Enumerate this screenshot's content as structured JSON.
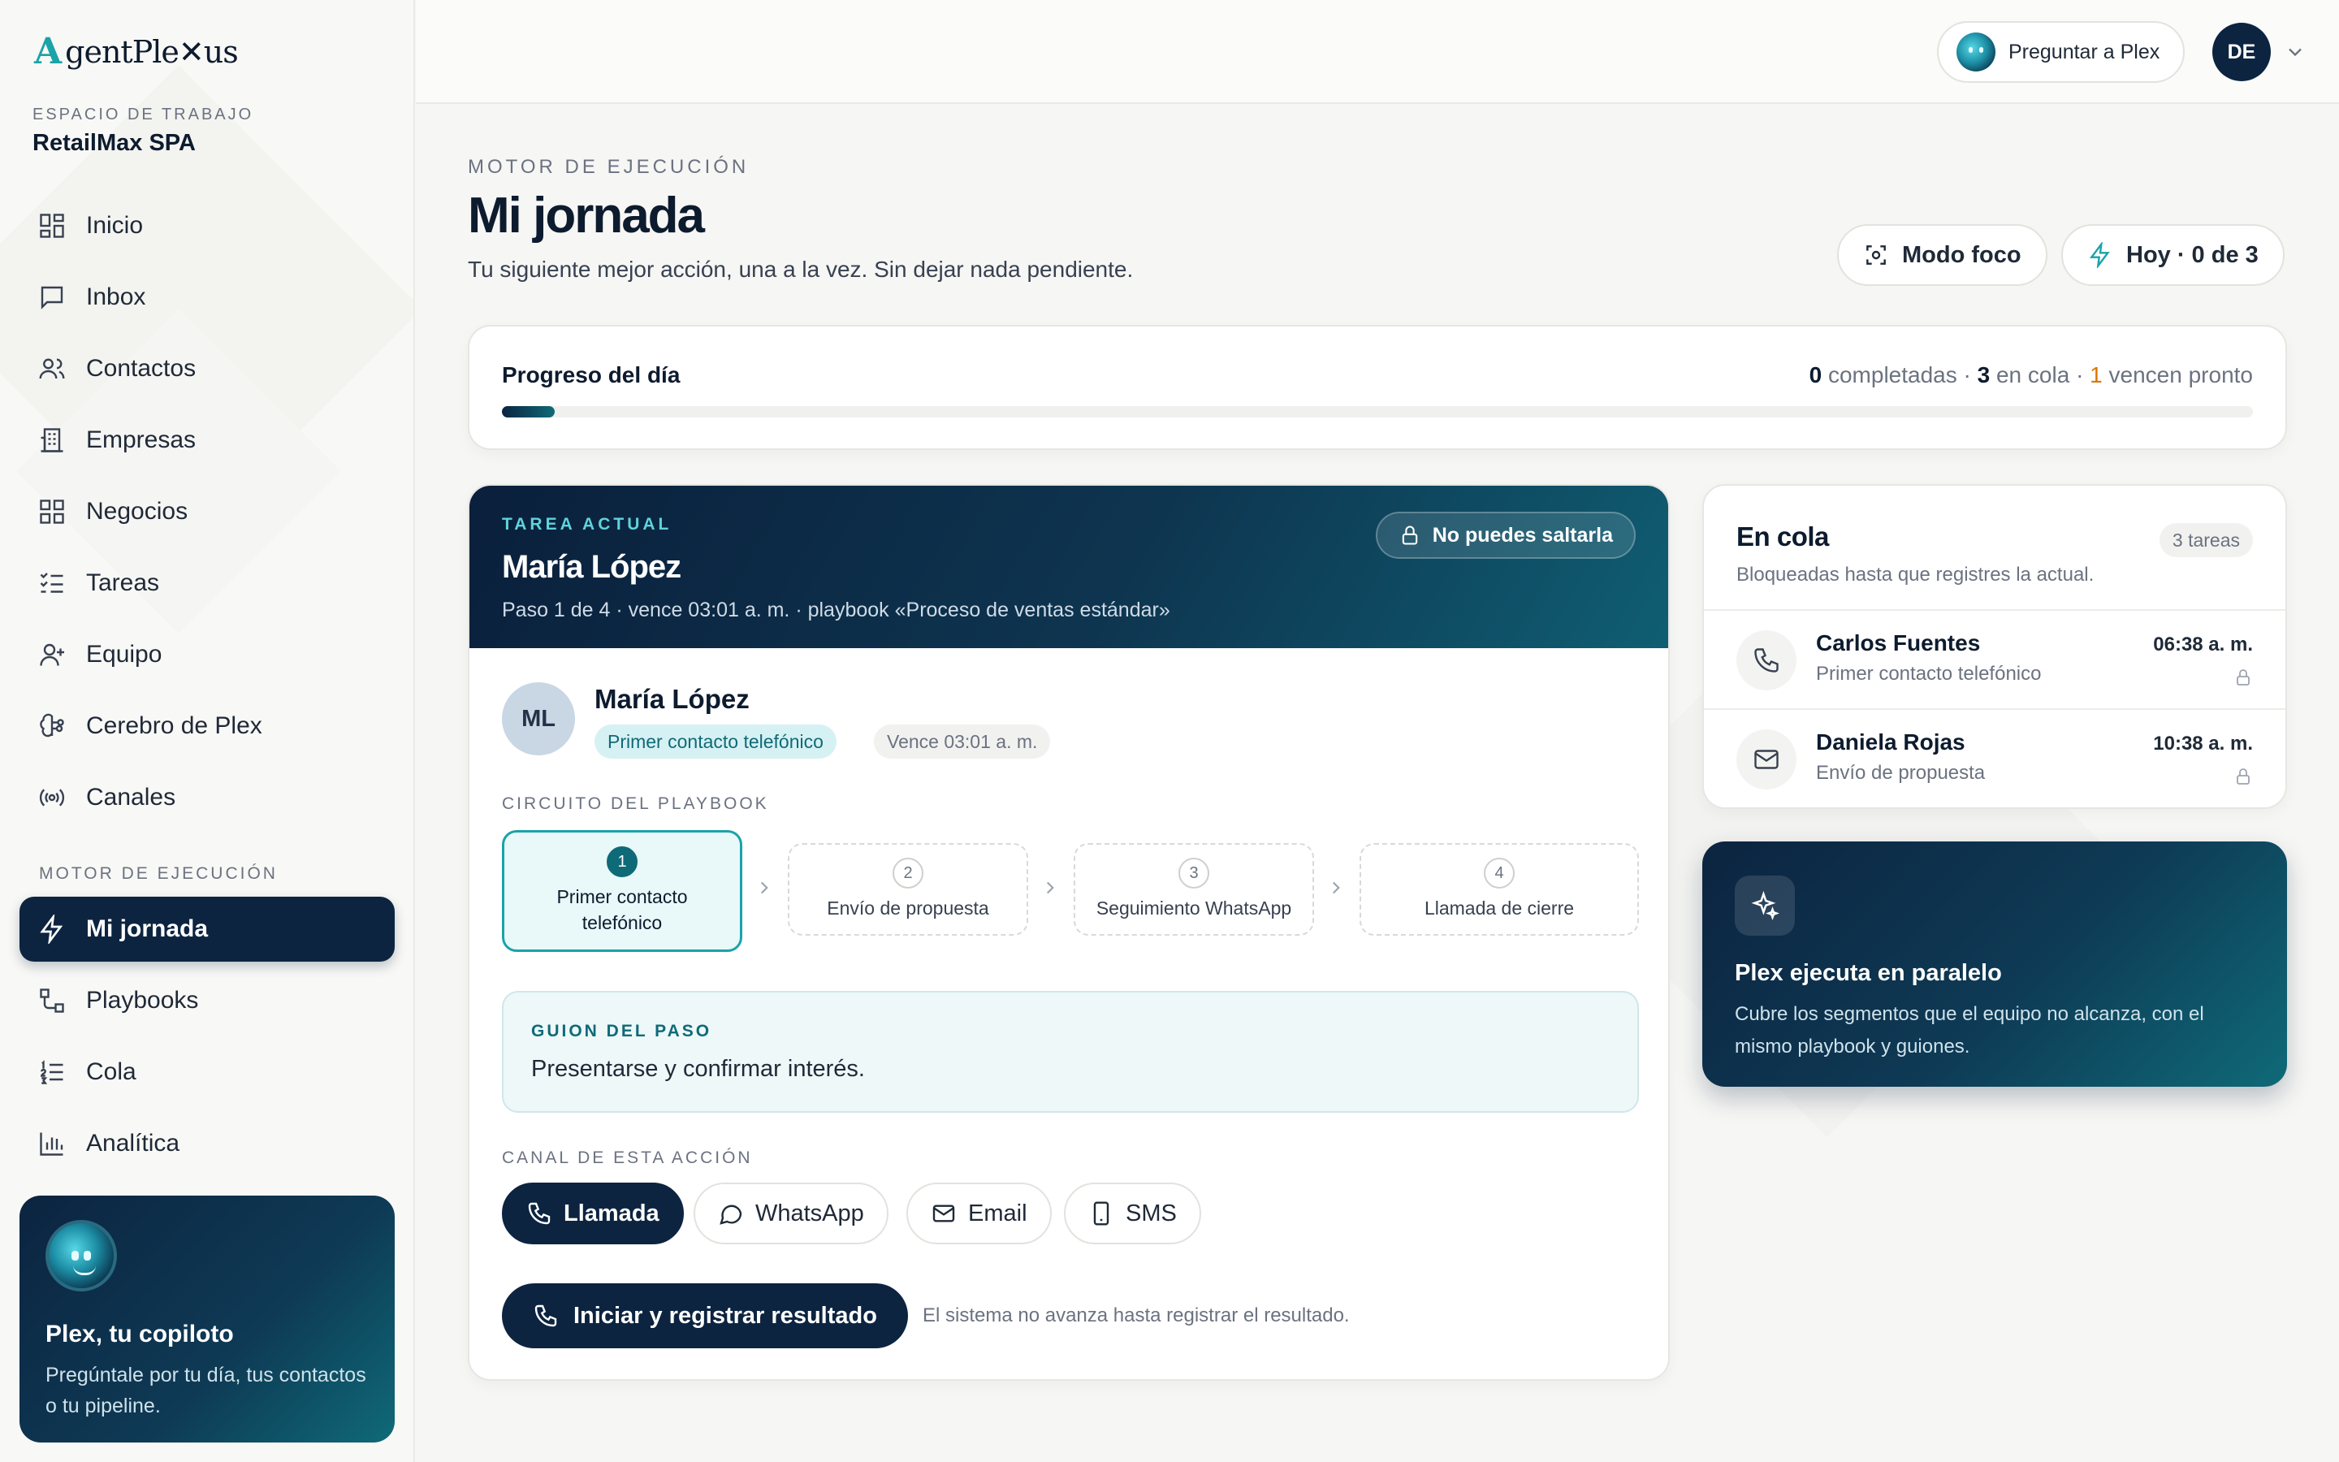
{
  "brand": {
    "logo_mark": "A",
    "logo_text": "gentPle✕us"
  },
  "workspace": {
    "label": "ESPACIO DE TRABAJO",
    "name": "RetailMax SPA"
  },
  "sidebar": {
    "items": [
      {
        "label": "Inicio",
        "icon": "grid-icon"
      },
      {
        "label": "Inbox",
        "icon": "message-icon"
      },
      {
        "label": "Contactos",
        "icon": "users-icon"
      },
      {
        "label": "Empresas",
        "icon": "building-icon"
      },
      {
        "label": "Negocios",
        "icon": "grid-icon"
      },
      {
        "label": "Tareas",
        "icon": "checklist-icon"
      },
      {
        "label": "Equipo",
        "icon": "user-plus-icon"
      },
      {
        "label": "Cerebro de Plex",
        "icon": "brain-icon"
      },
      {
        "label": "Canales",
        "icon": "broadcast-icon"
      }
    ],
    "section_label": "MOTOR DE EJECUCIÓN",
    "section_items": [
      {
        "label": "Mi jornada",
        "icon": "bolt-icon",
        "active": true
      },
      {
        "label": "Playbooks",
        "icon": "flow-icon"
      },
      {
        "label": "Cola",
        "icon": "list-ordered-icon"
      },
      {
        "label": "Analítica",
        "icon": "bar-chart-icon"
      }
    ],
    "copilot": {
      "title": "Plex, tu copiloto",
      "text": "Pregúntale por tu día, tus contactos o tu pipeline."
    }
  },
  "topbar": {
    "ask_label": "Preguntar a Plex",
    "avatar_initials": "DE"
  },
  "header": {
    "kicker": "MOTOR DE EJECUCIÓN",
    "title": "Mi jornada",
    "subtitle": "Tu siguiente mejor acción, una a la vez. Sin dejar nada pendiente.",
    "focus_button": "Modo foco",
    "today_button": "Hoy · 0 de 3"
  },
  "progress": {
    "title": "Progreso del día",
    "completed": "0",
    "completed_label": "completadas",
    "queued": "3",
    "queued_label": "en cola",
    "due_soon": "1",
    "due_soon_label": "vencen pronto",
    "sep": "·"
  },
  "task": {
    "kicker": "TAREA ACTUAL",
    "name": "María López",
    "meta": "Paso 1 de 4 · vence 03:01 a. m. · playbook «Proceso de ventas estándar»",
    "no_skip": "No puedes saltarla",
    "contact": {
      "initials": "ML",
      "name": "María López",
      "tag": "Primer contacto telefónico",
      "due": "Vence 03:01 a. m."
    },
    "circuit_label": "CIRCUITO DEL PLAYBOOK",
    "steps": [
      {
        "num": "1",
        "label": "Primer contacto telefónico"
      },
      {
        "num": "2",
        "label": "Envío de propuesta"
      },
      {
        "num": "3",
        "label": "Seguimiento WhatsApp"
      },
      {
        "num": "4",
        "label": "Llamada de cierre"
      }
    ],
    "script_label": "GUION DEL PASO",
    "script_text": "Presentarse y confirmar interés.",
    "channel_label": "CANAL DE ESTA ACCIÓN",
    "channels": [
      "Llamada",
      "WhatsApp",
      "Email",
      "SMS"
    ],
    "cta": "Iniciar y registrar resultado",
    "cta_note": "El sistema no avanza hasta registrar el resultado."
  },
  "queue": {
    "title": "En cola",
    "count": "3 tareas",
    "subtitle": "Bloqueadas hasta que registres la actual.",
    "items": [
      {
        "name": "Carlos Fuentes",
        "step": "Primer contacto telefónico",
        "time": "06:38 a. m.",
        "icon": "phone-icon"
      },
      {
        "name": "Daniela Rojas",
        "step": "Envío de propuesta",
        "time": "10:38 a. m.",
        "icon": "mail-icon"
      }
    ]
  },
  "parallel": {
    "title": "Plex ejecuta en paralelo",
    "text": "Cubre los segmentos que el equipo no alcanza, con el mismo playbook y guiones."
  },
  "colors": {
    "navy": "#0c2440",
    "teal": "#0f6a78",
    "accent": "#1aa3a8",
    "warning": "#d97706"
  }
}
